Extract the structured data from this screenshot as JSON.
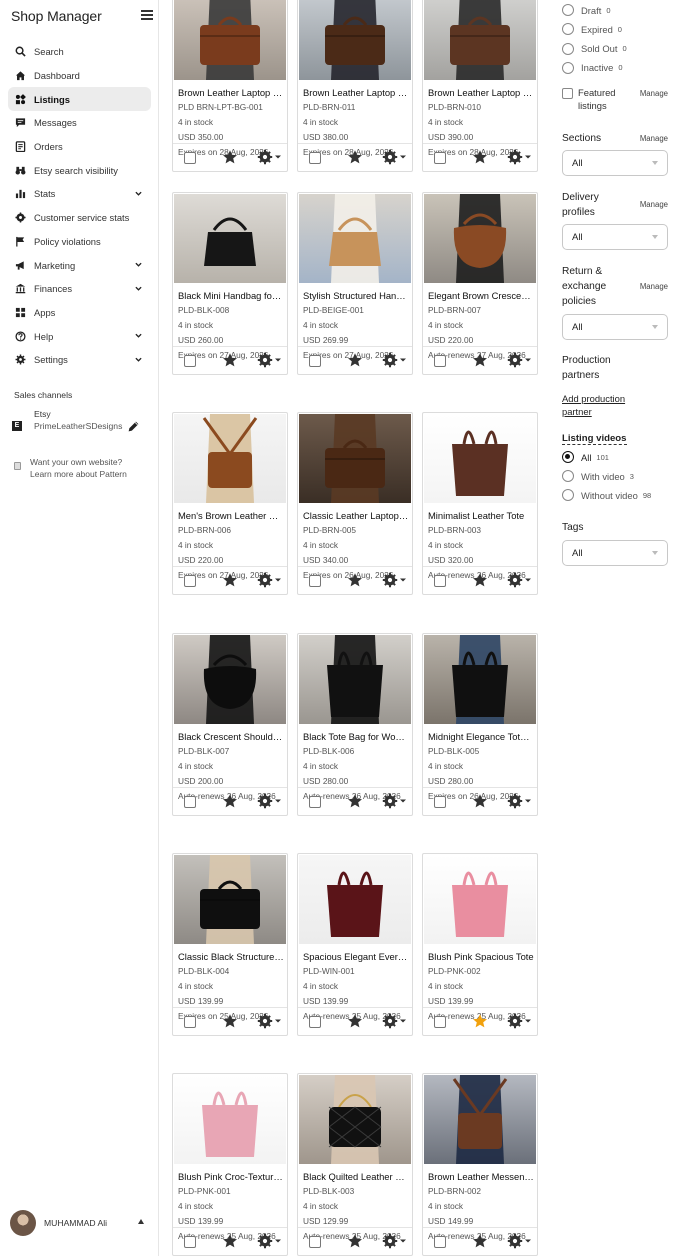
{
  "sidebar": {
    "title": "Shop Manager",
    "nav": [
      {
        "label": "Search",
        "icon": "search-icon",
        "chevron": false,
        "active": false
      },
      {
        "label": "Dashboard",
        "icon": "home-icon",
        "chevron": false,
        "active": false
      },
      {
        "label": "Listings",
        "icon": "listings-icon",
        "chevron": false,
        "active": true
      },
      {
        "label": "Messages",
        "icon": "messages-icon",
        "chevron": false,
        "active": false
      },
      {
        "label": "Orders",
        "icon": "orders-icon",
        "chevron": false,
        "active": false
      },
      {
        "label": "Etsy search visibility",
        "icon": "binoculars-icon",
        "chevron": false,
        "active": false
      },
      {
        "label": "Stats",
        "icon": "stats-icon",
        "chevron": true,
        "active": false
      },
      {
        "label": "Customer service stats",
        "icon": "gear-badge-icon",
        "chevron": false,
        "active": false
      },
      {
        "label": "Policy violations",
        "icon": "flag-icon",
        "chevron": false,
        "active": false
      },
      {
        "label": "Marketing",
        "icon": "megaphone-icon",
        "chevron": true,
        "active": false
      },
      {
        "label": "Finances",
        "icon": "bank-icon",
        "chevron": true,
        "active": false
      },
      {
        "label": "Apps",
        "icon": "apps-icon",
        "chevron": false,
        "active": false
      },
      {
        "label": "Help",
        "icon": "help-icon",
        "chevron": true,
        "active": false
      },
      {
        "label": "Settings",
        "icon": "settings-icon",
        "chevron": true,
        "active": false
      }
    ],
    "sales_channels_title": "Sales channels",
    "channel": {
      "name": "Etsy",
      "shop": "PrimeLeatherSDesigns"
    },
    "pattern": {
      "line1": "Want your own website?",
      "line2": "Learn more about Pattern"
    },
    "user": {
      "name": "MUHAMMAD Ali"
    }
  },
  "listings": [
    {
      "title": "Brown Leather Laptop Bag",
      "sku": "PLD BRN-LPT-BG-001",
      "stock": "4 in stock",
      "price": "USD 350.00",
      "expiry": "Expires on 28 Aug, 2026",
      "starred": false
    },
    {
      "title": "Brown Leather Laptop Bag",
      "sku": "PLD-BRN-011",
      "stock": "4 in stock",
      "price": "USD 380.00",
      "expiry": "Expires on 28 Aug, 2026",
      "starred": false
    },
    {
      "title": "Brown Leather Laptop Bag",
      "sku": "PLD-BRN-010",
      "stock": "4 in stock",
      "price": "USD 390.00",
      "expiry": "Expires on 28 Aug, 2026",
      "starred": false
    },
    {
      "title": "Black Mini Handbag for Women",
      "sku": "PLD-BLK-008",
      "stock": "4 in stock",
      "price": "USD 260.00",
      "expiry": "Expires on 27 Aug, 2026",
      "starred": false
    },
    {
      "title": "Stylish Structured Handbag",
      "sku": "PLD-BEIGE-001",
      "stock": "4 in stock",
      "price": "USD 269.99",
      "expiry": "Expires on 27 Aug, 2026",
      "starred": false
    },
    {
      "title": "Elegant Brown Crescent Bag",
      "sku": "PLD-BRN-007",
      "stock": "4 in stock",
      "price": "USD 220.00",
      "expiry": "Auto-renews 27 Aug, 2026",
      "starred": false
    },
    {
      "title": "Men's Brown Leather Bag",
      "sku": "PLD-BRN-006",
      "stock": "4 in stock",
      "price": "USD 220.00",
      "expiry": "Expires on 27 Aug, 2026",
      "starred": false
    },
    {
      "title": "Classic Leather Laptop Bag",
      "sku": "PLD-BRN-005",
      "stock": "4 in stock",
      "price": "USD 340.00",
      "expiry": "Expires on 26 Aug, 2026",
      "starred": false
    },
    {
      "title": "Minimalist Leather Tote",
      "sku": "PLD-BRN-003",
      "stock": "4 in stock",
      "price": "USD 320.00",
      "expiry": "Auto-renews 26 Aug, 2026",
      "starred": false
    },
    {
      "title": "Black Crescent Shoulder Bag",
      "sku": "PLD-BLK-007",
      "stock": "4 in stock",
      "price": "USD 200.00",
      "expiry": "Auto-renews 26 Aug, 2026",
      "starred": false
    },
    {
      "title": "Black Tote Bag for Women",
      "sku": "PLD-BLK-006",
      "stock": "4 in stock",
      "price": "USD 280.00",
      "expiry": "Auto-renews 26 Aug, 2026",
      "starred": false
    },
    {
      "title": "Midnight Elegance Tote Bag",
      "sku": "PLD-BLK-005",
      "stock": "4 in stock",
      "price": "USD 280.00",
      "expiry": "Expires on 26 Aug, 2026",
      "starred": false
    },
    {
      "title": "Classic Black Structured Bag",
      "sku": "PLD-BLK-004",
      "stock": "4 in stock",
      "price": "USD 139.99",
      "expiry": "Expires on 25 Aug, 2026",
      "starred": false
    },
    {
      "title": "Spacious Elegant Everyday Tote",
      "sku": "PLD-WIN-001",
      "stock": "4 in stock",
      "price": "USD 139.99",
      "expiry": "Auto-renews 25 Aug, 2026",
      "starred": false
    },
    {
      "title": "Blush Pink Spacious Tote",
      "sku": "PLD-PNK-002",
      "stock": "4 in stock",
      "price": "USD 139.99",
      "expiry": "Auto-renews 25 Aug, 2026",
      "starred": true
    },
    {
      "title": "Blush Pink Croc-Textured Tote",
      "sku": "PLD-PNK-001",
      "stock": "4 in stock",
      "price": "USD 139.99",
      "expiry": "Auto-renews 25 Aug, 2026",
      "starred": false
    },
    {
      "title": "Black Quilted Leather Bag",
      "sku": "PLD-BLK-003",
      "stock": "4 in stock",
      "price": "USD 129.99",
      "expiry": "Auto-renews 25 Aug, 2026",
      "starred": false
    },
    {
      "title": "Brown Leather Messenger Bag",
      "sku": "PLD-BRN-002",
      "stock": "4 in stock",
      "price": "USD 149.99",
      "expiry": "Auto-renews 25 Aug, 2026",
      "starred": false
    }
  ],
  "filters": {
    "status_options": [
      {
        "label": "Draft",
        "count": "0"
      },
      {
        "label": "Expired",
        "count": "0"
      },
      {
        "label": "Sold Out",
        "count": "0"
      },
      {
        "label": "Inactive",
        "count": "0"
      }
    ],
    "featured_label": "Featured listings",
    "manage_label": "Manage",
    "sections": {
      "label": "Sections",
      "value": "All"
    },
    "delivery": {
      "label": "Delivery profiles",
      "value": "All"
    },
    "returns": {
      "label": "Return & exchange policies",
      "value": "All"
    },
    "production": {
      "label": "Production partners",
      "link": "Add production partner"
    },
    "videos": {
      "label": "Listing videos",
      "options": [
        {
          "label": "All",
          "count": "101",
          "checked": true
        },
        {
          "label": "With video",
          "count": "3",
          "checked": false
        },
        {
          "label": "Without video",
          "count": "98",
          "checked": false
        }
      ]
    },
    "tags": {
      "label": "Tags",
      "value": "All"
    }
  },
  "colors": {
    "active_nav_bg": "#ececec",
    "star_active": "#f1a10d",
    "border": "#dcdcdc"
  }
}
